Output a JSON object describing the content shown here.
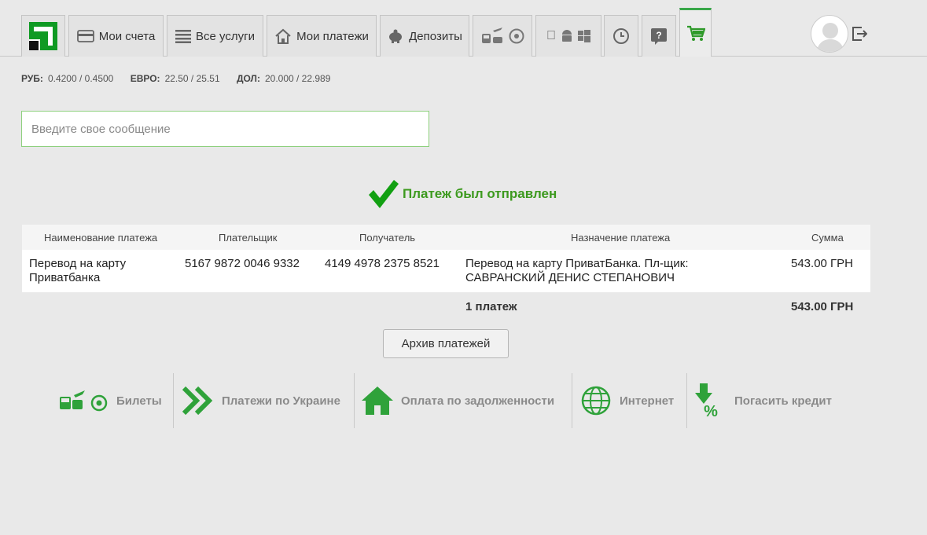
{
  "nav": {
    "tabs": [
      {
        "label": "Мои счета",
        "icon": "card-icon"
      },
      {
        "label": "Все услуги",
        "icon": "list-icon"
      },
      {
        "label": "Мои платежи",
        "icon": "home-icon"
      },
      {
        "label": "Депозиты",
        "icon": "piggy-bank-icon"
      }
    ],
    "icon_tabs": [
      "transport-icon",
      "ball-icon",
      "apple-icon",
      "android-icon",
      "windows-icon",
      "history-icon",
      "help-icon",
      "cart-icon"
    ]
  },
  "rates": [
    {
      "currency": "РУБ:",
      "value": "0.4200 / 0.4500"
    },
    {
      "currency": "ЕВРО:",
      "value": "22.50 / 25.51"
    },
    {
      "currency": "ДОЛ:",
      "value": "20.000 / 22.989"
    }
  ],
  "message": {
    "placeholder": "Введите свое сообщение"
  },
  "status": {
    "text": "Платеж был отправлен"
  },
  "table": {
    "headers": [
      "Наименование платежа",
      "Плательщик",
      "Получатель",
      "Назначение платежа",
      "Сумма"
    ],
    "row": {
      "name_line1": "Перевод на карту",
      "name_line2": "Приватбанка",
      "payer": "5167 9872 0046 9332",
      "receiver": "4149 4978 2375 8521",
      "purpose_line1": "Перевод на карту ПриватБанка. Пл-щик:",
      "purpose_line2": "САВРАНСКИЙ ДЕНИС СТЕПАНОВИЧ",
      "amount": "543.00 ГРН"
    },
    "total": {
      "count": "1 платеж",
      "amount": "543.00 ГРН"
    }
  },
  "archive_button": "Архив платежей",
  "bottom_nav": [
    {
      "label": "Билеты",
      "icon": "tickets-icon"
    },
    {
      "label": "Платежи по Украине",
      "icon": "double-chevron-icon"
    },
    {
      "label": "Оплата по задолженности",
      "icon": "house-icon"
    },
    {
      "label": "Интернет",
      "icon": "globe-icon"
    },
    {
      "label": "Погасить кредит",
      "icon": "percent-down-icon"
    }
  ],
  "colors": {
    "accent": "#3aa84a",
    "success": "#3d9a1f",
    "brand": "#0b9d1c"
  }
}
